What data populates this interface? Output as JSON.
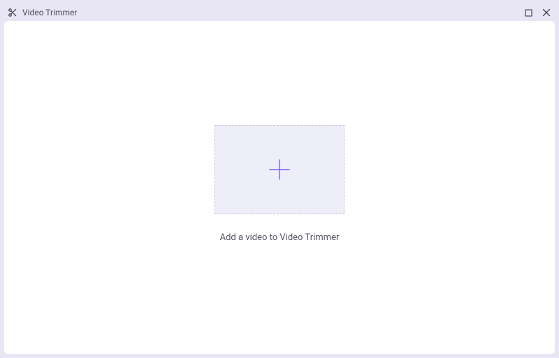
{
  "header": {
    "app_title": "Video Trimmer"
  },
  "main": {
    "prompt": "Add a video to Video Trimmer"
  },
  "icons": {
    "app": "scissors-icon",
    "add": "plus-icon",
    "maximize": "maximize-icon",
    "close": "close-icon"
  }
}
